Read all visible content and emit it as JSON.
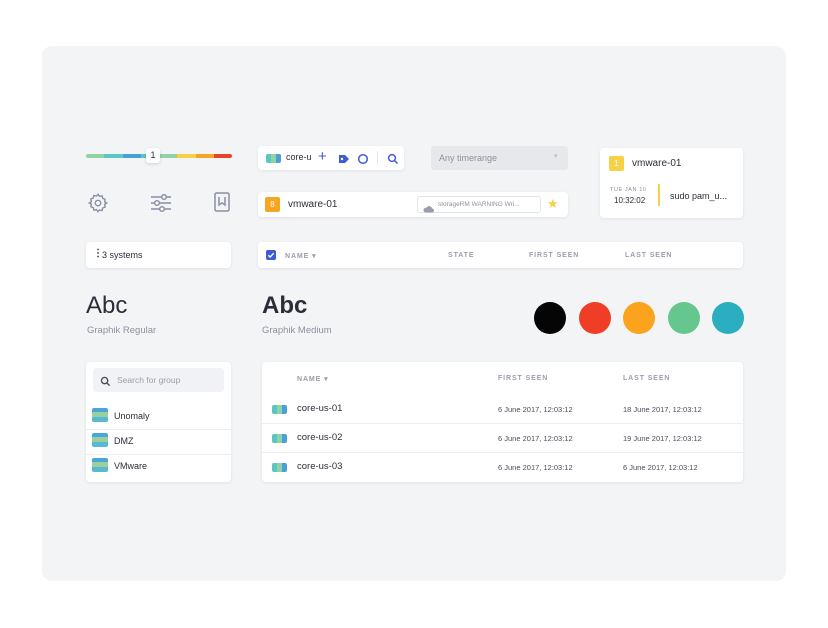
{
  "slider": {
    "value": "1",
    "segments": [
      {
        "color": "#8fd3a7"
      },
      {
        "color": "#5cc6c0"
      },
      {
        "color": "#4a9fd8"
      },
      {
        "color": "#5cc6c0"
      },
      {
        "color": "#8fd3a7"
      },
      {
        "color": "#f6d046"
      },
      {
        "color": "#f6a623"
      },
      {
        "color": "#e8432b"
      }
    ]
  },
  "toolbar": {
    "host_label": "core-u"
  },
  "timerange": {
    "placeholder": "Any timerange"
  },
  "event_card": {
    "badge": "1",
    "title": "vmware-01",
    "date": "TUE JAN 10",
    "time": "10:32:02",
    "command": "sudo pam_u..."
  },
  "icons": [
    "gear-icon",
    "sliders-icon",
    "bookmark-icon"
  ],
  "alert_row": {
    "badge": "8",
    "host": "vmware-01",
    "warning": "storageRM WARNING Wri..."
  },
  "systems_selector": {
    "label": "3 systems"
  },
  "header_row": {
    "name": "NAME",
    "state": "STATE",
    "first_seen": "FIRST SEEN",
    "last_seen": "LAST SEEN"
  },
  "typography": [
    {
      "sample": "Abc",
      "label": "Graphik Regular"
    },
    {
      "sample": "Abc",
      "label": "Graphik Medium"
    }
  ],
  "palette": [
    "#050505",
    "#ef3e25",
    "#fba31d",
    "#65c78d",
    "#2baec0"
  ],
  "groups": {
    "search_placeholder": "Search for group",
    "items": [
      "Unomaly",
      "DMZ",
      "VMware"
    ]
  },
  "hosts_table": {
    "columns": {
      "name": "NAME",
      "first_seen": "FIRST SEEN",
      "last_seen": "LAST SEEN"
    },
    "rows": [
      {
        "name": "core-us-01",
        "first_seen": "6 June 2017, 12:03:12",
        "last_seen": "18 June 2017, 12:03:12"
      },
      {
        "name": "core-us-02",
        "first_seen": "6 June 2017, 12:03:12",
        "last_seen": "19 June 2017, 12:03:12"
      },
      {
        "name": "core-us-03",
        "first_seen": "6 June 2017, 12:03:12",
        "last_seen": "6 June 2017, 12:03:12"
      }
    ]
  },
  "colors": {
    "accent": "#3f5bd8",
    "badge_orange": "#f6a623",
    "badge_yellow": "#f6d046"
  }
}
